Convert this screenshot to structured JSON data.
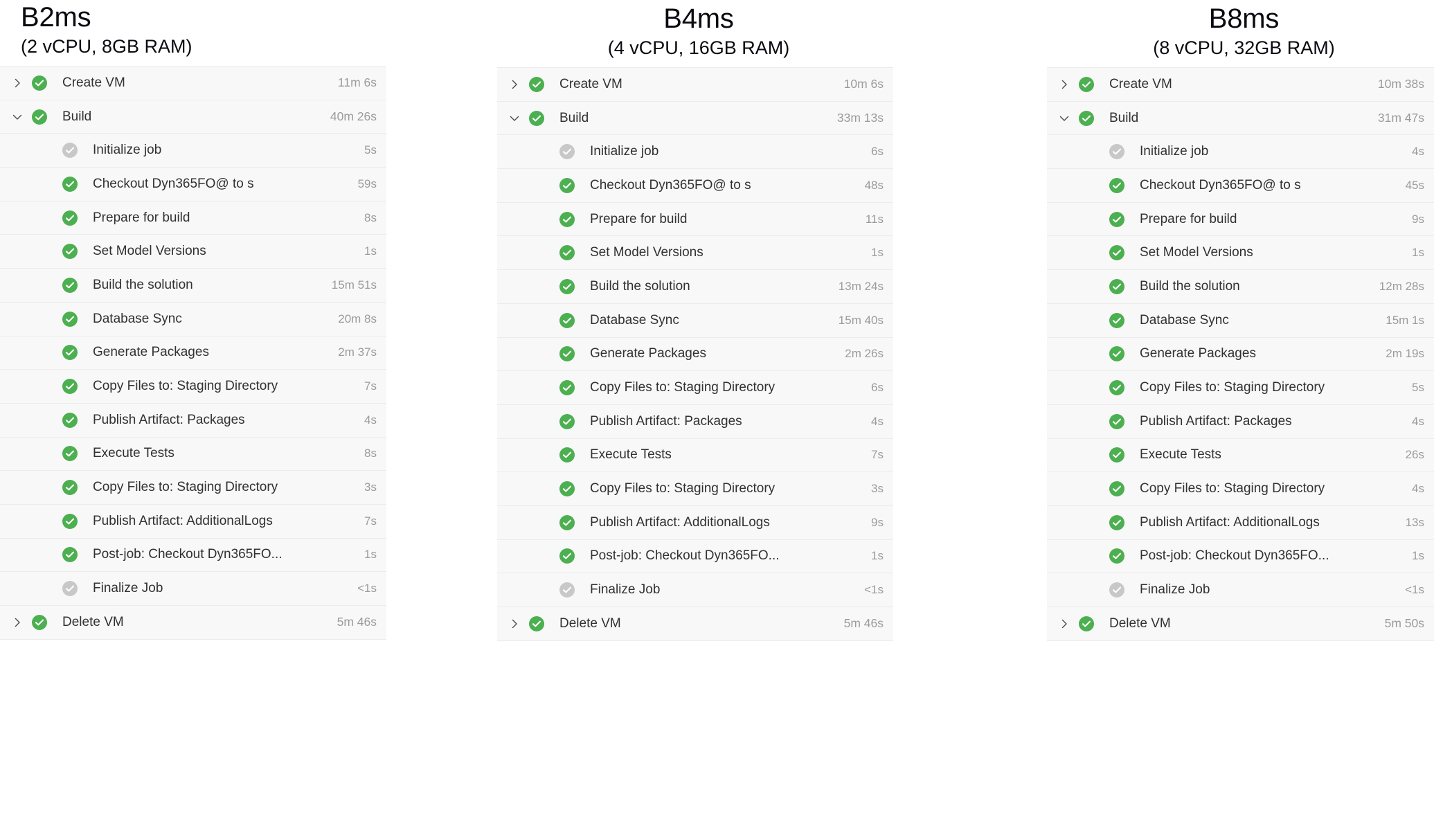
{
  "colors": {
    "success": "#4caf50",
    "neutral": "#c8c8c8",
    "row_bg": "#f8f8f8",
    "divider": "#ebebeb",
    "label_text": "#323130",
    "duration_text": "#9b9b9b"
  },
  "panels": [
    {
      "title": "B2ms",
      "subtitle": "(2 vCPU, 8GB RAM)",
      "rows": [
        {
          "level": "top",
          "chevron": "chevron-right",
          "status": "success",
          "label": "Create VM",
          "duration": "11m 6s"
        },
        {
          "level": "top",
          "chevron": "chevron-down",
          "status": "success",
          "label": "Build",
          "duration": "40m 26s"
        },
        {
          "level": "sub",
          "chevron": "none",
          "status": "neutral",
          "label": "Initialize job",
          "duration": "5s"
        },
        {
          "level": "sub",
          "chevron": "none",
          "status": "success",
          "label": "Checkout Dyn365FO@ to s",
          "duration": "59s"
        },
        {
          "level": "sub",
          "chevron": "none",
          "status": "success",
          "label": "Prepare for build",
          "duration": "8s"
        },
        {
          "level": "sub",
          "chevron": "none",
          "status": "success",
          "label": "Set Model Versions",
          "duration": "1s"
        },
        {
          "level": "sub",
          "chevron": "none",
          "status": "success",
          "label": "Build the solution",
          "duration": "15m 51s"
        },
        {
          "level": "sub",
          "chevron": "none",
          "status": "success",
          "label": "Database Sync",
          "duration": "20m 8s"
        },
        {
          "level": "sub",
          "chevron": "none",
          "status": "success",
          "label": "Generate Packages",
          "duration": "2m 37s"
        },
        {
          "level": "sub",
          "chevron": "none",
          "status": "success",
          "label": "Copy Files to: Staging Directory",
          "duration": "7s"
        },
        {
          "level": "sub",
          "chevron": "none",
          "status": "success",
          "label": "Publish Artifact: Packages",
          "duration": "4s"
        },
        {
          "level": "sub",
          "chevron": "none",
          "status": "success",
          "label": "Execute Tests",
          "duration": "8s"
        },
        {
          "level": "sub",
          "chevron": "none",
          "status": "success",
          "label": "Copy Files to: Staging Directory",
          "duration": "3s"
        },
        {
          "level": "sub",
          "chevron": "none",
          "status": "success",
          "label": "Publish Artifact: AdditionalLogs",
          "duration": "7s"
        },
        {
          "level": "sub",
          "chevron": "none",
          "status": "success",
          "label": "Post-job: Checkout Dyn365FO...",
          "duration": "1s"
        },
        {
          "level": "sub",
          "chevron": "none",
          "status": "neutral",
          "label": "Finalize Job",
          "duration": "<1s"
        },
        {
          "level": "top",
          "chevron": "chevron-right",
          "status": "success",
          "label": "Delete VM",
          "duration": "5m 46s"
        }
      ]
    },
    {
      "title": "B4ms",
      "subtitle": "(4 vCPU, 16GB RAM)",
      "rows": [
        {
          "level": "top",
          "chevron": "chevron-right",
          "status": "success",
          "label": "Create VM",
          "duration": "10m 6s"
        },
        {
          "level": "top",
          "chevron": "chevron-down",
          "status": "success",
          "label": "Build",
          "duration": "33m 13s"
        },
        {
          "level": "sub",
          "chevron": "none",
          "status": "neutral",
          "label": "Initialize job",
          "duration": "6s"
        },
        {
          "level": "sub",
          "chevron": "none",
          "status": "success",
          "label": "Checkout Dyn365FO@ to s",
          "duration": "48s"
        },
        {
          "level": "sub",
          "chevron": "none",
          "status": "success",
          "label": "Prepare for build",
          "duration": "11s"
        },
        {
          "level": "sub",
          "chevron": "none",
          "status": "success",
          "label": "Set Model Versions",
          "duration": "1s"
        },
        {
          "level": "sub",
          "chevron": "none",
          "status": "success",
          "label": "Build the solution",
          "duration": "13m 24s"
        },
        {
          "level": "sub",
          "chevron": "none",
          "status": "success",
          "label": "Database Sync",
          "duration": "15m 40s"
        },
        {
          "level": "sub",
          "chevron": "none",
          "status": "success",
          "label": "Generate Packages",
          "duration": "2m 26s"
        },
        {
          "level": "sub",
          "chevron": "none",
          "status": "success",
          "label": "Copy Files to: Staging Directory",
          "duration": "6s"
        },
        {
          "level": "sub",
          "chevron": "none",
          "status": "success",
          "label": "Publish Artifact: Packages",
          "duration": "4s"
        },
        {
          "level": "sub",
          "chevron": "none",
          "status": "success",
          "label": "Execute Tests",
          "duration": "7s"
        },
        {
          "level": "sub",
          "chevron": "none",
          "status": "success",
          "label": "Copy Files to: Staging Directory",
          "duration": "3s"
        },
        {
          "level": "sub",
          "chevron": "none",
          "status": "success",
          "label": "Publish Artifact: AdditionalLogs",
          "duration": "9s"
        },
        {
          "level": "sub",
          "chevron": "none",
          "status": "success",
          "label": "Post-job: Checkout Dyn365FO...",
          "duration": "1s"
        },
        {
          "level": "sub",
          "chevron": "none",
          "status": "neutral",
          "label": "Finalize Job",
          "duration": "<1s"
        },
        {
          "level": "top",
          "chevron": "chevron-right",
          "status": "success",
          "label": "Delete VM",
          "duration": "5m 46s"
        }
      ]
    },
    {
      "title": "B8ms",
      "subtitle": "(8 vCPU, 32GB RAM)",
      "rows": [
        {
          "level": "top",
          "chevron": "chevron-right",
          "status": "success",
          "label": "Create VM",
          "duration": "10m 38s"
        },
        {
          "level": "top",
          "chevron": "chevron-down",
          "status": "success",
          "label": "Build",
          "duration": "31m 47s"
        },
        {
          "level": "sub",
          "chevron": "none",
          "status": "neutral",
          "label": "Initialize job",
          "duration": "4s"
        },
        {
          "level": "sub",
          "chevron": "none",
          "status": "success",
          "label": "Checkout Dyn365FO@ to s",
          "duration": "45s"
        },
        {
          "level": "sub",
          "chevron": "none",
          "status": "success",
          "label": "Prepare for build",
          "duration": "9s"
        },
        {
          "level": "sub",
          "chevron": "none",
          "status": "success",
          "label": "Set Model Versions",
          "duration": "1s"
        },
        {
          "level": "sub",
          "chevron": "none",
          "status": "success",
          "label": "Build the solution",
          "duration": "12m 28s"
        },
        {
          "level": "sub",
          "chevron": "none",
          "status": "success",
          "label": "Database Sync",
          "duration": "15m 1s"
        },
        {
          "level": "sub",
          "chevron": "none",
          "status": "success",
          "label": "Generate Packages",
          "duration": "2m 19s"
        },
        {
          "level": "sub",
          "chevron": "none",
          "status": "success",
          "label": "Copy Files to: Staging Directory",
          "duration": "5s"
        },
        {
          "level": "sub",
          "chevron": "none",
          "status": "success",
          "label": "Publish Artifact: Packages",
          "duration": "4s"
        },
        {
          "level": "sub",
          "chevron": "none",
          "status": "success",
          "label": "Execute Tests",
          "duration": "26s"
        },
        {
          "level": "sub",
          "chevron": "none",
          "status": "success",
          "label": "Copy Files to: Staging Directory",
          "duration": "4s"
        },
        {
          "level": "sub",
          "chevron": "none",
          "status": "success",
          "label": "Publish Artifact: AdditionalLogs",
          "duration": "13s"
        },
        {
          "level": "sub",
          "chevron": "none",
          "status": "success",
          "label": "Post-job: Checkout Dyn365FO...",
          "duration": "1s"
        },
        {
          "level": "sub",
          "chevron": "none",
          "status": "neutral",
          "label": "Finalize Job",
          "duration": "<1s"
        },
        {
          "level": "top",
          "chevron": "chevron-right",
          "status": "success",
          "label": "Delete VM",
          "duration": "5m 50s"
        }
      ]
    }
  ]
}
